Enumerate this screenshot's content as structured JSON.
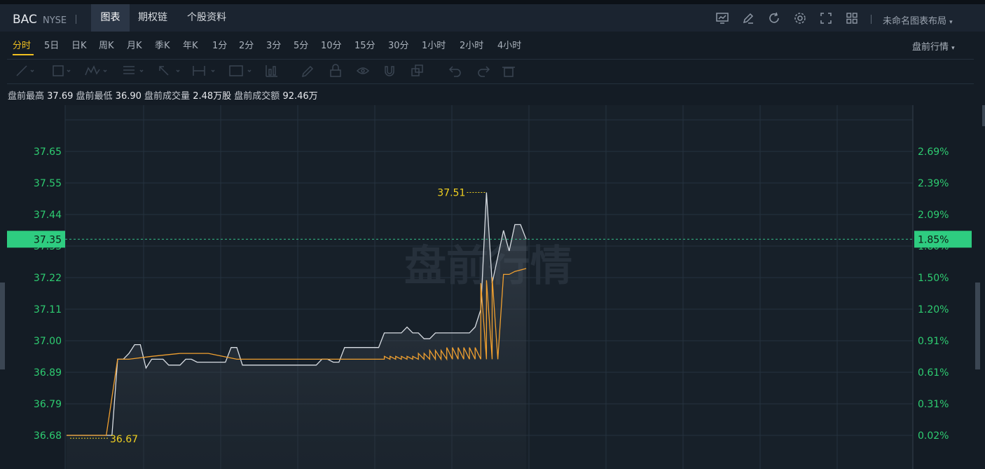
{
  "header": {
    "symbol": "BAC",
    "exchange": "NYSE",
    "tabs": [
      {
        "label": "图表",
        "active": true
      },
      {
        "label": "期权链",
        "active": false
      },
      {
        "label": "个股资料",
        "active": false
      }
    ],
    "toolbar_icons": [
      "chart-settings-icon",
      "pen-icon",
      "refresh-icon",
      "gear-icon",
      "fullscreen-icon",
      "grid-layout-icon"
    ],
    "layout_label": "未命名图表布局"
  },
  "periods": [
    {
      "label": "分时",
      "active": true
    },
    {
      "label": "5日"
    },
    {
      "label": "日K"
    },
    {
      "label": "周K"
    },
    {
      "label": "月K"
    },
    {
      "label": "季K"
    },
    {
      "label": "年K"
    },
    {
      "label": "1分"
    },
    {
      "label": "2分"
    },
    {
      "label": "3分"
    },
    {
      "label": "5分"
    },
    {
      "label": "10分"
    },
    {
      "label": "15分"
    },
    {
      "label": "30分"
    },
    {
      "label": "1小时"
    },
    {
      "label": "2小时"
    },
    {
      "label": "4小时"
    }
  ],
  "session_label": "盘前行情",
  "drawing_tools": [
    "trend-line-icon",
    "rectangle-icon",
    "pattern-icon",
    "fib-icon",
    "arrow-icon",
    "measure-icon",
    "text-icon",
    "indicator-icon",
    "pencil-icon",
    "lock-icon",
    "eye-icon",
    "magnet-icon",
    "copy-icon",
    "undo-icon",
    "redo-icon",
    "trash-icon"
  ],
  "stats": {
    "high_label": "盘前最高",
    "high": "37.69",
    "low_label": "盘前最低",
    "low": "36.90",
    "volume_label": "盘前成交量",
    "volume": "2.48万股",
    "turnover_label": "盘前成交额",
    "turnover": "92.46万"
  },
  "watermark": "盘前行情",
  "colors": {
    "price_line": "#d8dde3",
    "avg_line": "#f0a030",
    "axis_green": "#2ecc71",
    "marker_yellow": "#f0d020",
    "current_bg": "#2ecc80"
  },
  "chart_data": {
    "type": "line",
    "y_ticks": [
      "37.65",
      "37.55",
      "37.44",
      "37.33",
      "37.22",
      "37.11",
      "37.00",
      "36.89",
      "36.79",
      "36.68"
    ],
    "pct_ticks": [
      "2.69%",
      "2.39%",
      "2.09%",
      "1.80%",
      "1.50%",
      "1.20%",
      "0.91%",
      "0.61%",
      "0.31%",
      "0.02%"
    ],
    "ylim": [
      36.63,
      37.72
    ],
    "x_count": 100,
    "series": [
      {
        "values": [
          36.68,
          36.68,
          36.68,
          36.68,
          36.68,
          36.68,
          36.68,
          36.68,
          36.68,
          36.68,
          36.94,
          36.94,
          36.96,
          36.99,
          36.99,
          36.91,
          36.94,
          36.94,
          36.94,
          36.92,
          36.92,
          36.92,
          36.94,
          36.94,
          36.93,
          36.93,
          36.93,
          36.93,
          36.93,
          36.93,
          36.98,
          36.98,
          36.92,
          36.92,
          36.92,
          36.92,
          36.92,
          36.92,
          36.92,
          36.92,
          36.92,
          36.92,
          36.92,
          36.92,
          36.92,
          36.92,
          36.94,
          36.94,
          36.93,
          36.93,
          36.98,
          36.98,
          36.98,
          36.98,
          36.98,
          36.98,
          36.98,
          37.03,
          37.03,
          37.03,
          37.03,
          37.05,
          37.03,
          37.03,
          37.01,
          37.01,
          37.03,
          37.03,
          37.03,
          37.03,
          37.03,
          37.03,
          37.03,
          37.05,
          37.11,
          37.51,
          37.2,
          37.29,
          37.38,
          37.31,
          37.4,
          37.4,
          37.35
        ],
        "times": [
          0,
          2,
          4,
          6,
          8,
          10,
          10.5,
          12,
          14,
          16,
          18,
          20,
          22,
          24,
          26,
          28,
          30,
          32,
          34,
          36,
          38,
          40,
          42,
          44,
          46,
          48,
          50,
          52,
          54,
          56,
          58,
          60,
          62,
          64,
          66,
          68,
          70,
          72,
          74,
          76,
          78,
          80,
          82,
          84,
          86,
          88,
          90,
          92,
          94,
          96,
          98,
          100,
          102,
          104,
          106,
          108,
          110,
          112,
          114,
          116,
          118,
          120,
          122,
          124,
          126,
          128,
          130,
          132,
          134,
          136,
          138,
          140,
          142,
          144,
          146,
          148,
          150,
          152,
          154,
          156,
          158,
          160,
          162
        ]
      },
      {
        "values": [
          36.68,
          36.68,
          36.68,
          36.68,
          36.68,
          36.68,
          36.94,
          36.94,
          36.95,
          36.96,
          36.96,
          36.94,
          36.94,
          36.94,
          36.94,
          36.94,
          36.94,
          36.94,
          36.94,
          36.94,
          36.94,
          36.94,
          36.94,
          36.94,
          36.94,
          36.94,
          36.94,
          36.94,
          36.94,
          36.94,
          36.94,
          36.94,
          36.94,
          36.94,
          36.94,
          36.94,
          36.94,
          36.94,
          36.94,
          36.94,
          36.94,
          36.94,
          36.95,
          36.95,
          36.95,
          36.95,
          36.95,
          36.95,
          36.96,
          36.96,
          36.97,
          36.97,
          36.97,
          36.98,
          36.98,
          36.98,
          36.98,
          36.98,
          36.98,
          37.2,
          37.21,
          37.22,
          37.23,
          37.23,
          37.24,
          37.25
        ],
        "times": [
          0,
          4,
          8,
          10,
          12,
          14,
          18,
          22,
          30,
          40,
          50,
          60,
          70,
          80,
          90,
          100,
          102,
          104,
          106,
          108,
          110,
          112,
          114,
          116,
          118,
          120,
          122,
          124,
          126,
          128,
          130,
          132,
          134,
          136,
          138,
          140,
          142,
          144,
          146,
          148,
          150,
          152,
          112,
          114,
          116,
          118,
          120,
          122,
          124,
          126,
          128,
          130,
          132,
          134,
          136,
          138,
          140,
          142,
          144,
          146,
          148,
          150,
          154,
          156,
          158,
          162
        ]
      }
    ],
    "current_price": "37.35",
    "current_pct": "1.85%",
    "high_marker": "37.51",
    "low_marker": "36.67"
  }
}
